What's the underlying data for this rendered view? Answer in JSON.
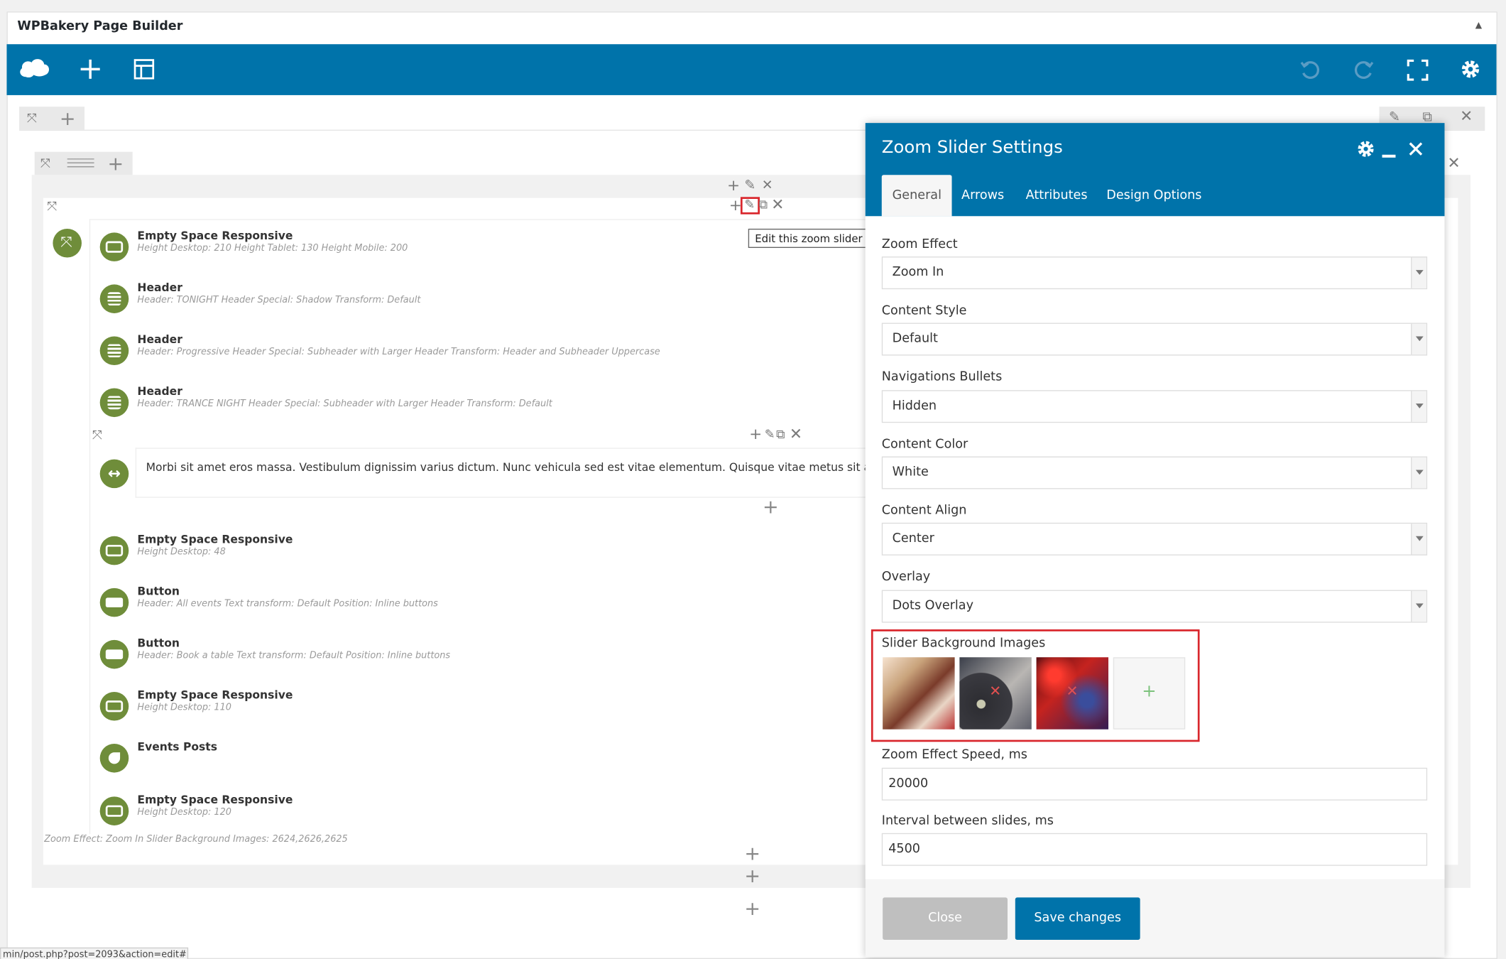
{
  "metabox": {
    "title": "WPBakery Page Builder",
    "toggle": "▲"
  },
  "navbar": {
    "logo": "cloud-logo-icon",
    "add": "plus-icon",
    "templates": "layout-icon",
    "undo": "undo-icon",
    "redo": "redo-icon",
    "fullscreen": "fullscreen-icon",
    "settings": "gear-icon"
  },
  "builder": {
    "tooltip": "Edit this zoom slider",
    "elements": [
      {
        "name": "Empty Space Responsive",
        "desc": "Height Desktop: 210  Height Tablet: 130  Height Mobile: 200"
      },
      {
        "name": "Header",
        "desc": "Header: TONIGHT  Header Special: Shadow  Transform: Default"
      },
      {
        "name": "Header",
        "desc": "Header: Progressive  Header Special: Subheader with Larger Header  Transform: Header and Subheader Uppercase"
      },
      {
        "name": "Header",
        "desc": "Header: TRANCE NIGHT  Header Special: Subheader with Larger Header  Transform: Default"
      }
    ],
    "text_block": "Morbi sit amet eros massa. Vestibulum dignissim varius dictum. Nunc vehicula sed est vitae elementum. Quisque vitae metus sit amet orci por",
    "elements2": [
      {
        "name": "Empty Space Responsive",
        "desc": "Height Desktop: 48"
      },
      {
        "name": "Button",
        "desc": "Header: All events  Text transform: Default  Position: Inline buttons"
      },
      {
        "name": "Button",
        "desc": "Header: Book a table  Text transform: Default  Position: Inline buttons"
      },
      {
        "name": "Empty Space Responsive",
        "desc": "Height Desktop: 110"
      },
      {
        "name": "Events Posts",
        "desc": ""
      },
      {
        "name": "Empty Space Responsive",
        "desc": "Height Desktop: 120"
      }
    ],
    "slider_summary": "Zoom Effect: Zoom In  Slider Background Images: 2624,2626,2625",
    "status_url": "min/post.php?post=2093&action=edit#"
  },
  "modal": {
    "title": "Zoom Slider Settings",
    "tabs": [
      "General",
      "Arrows",
      "Attributes",
      "Design Options"
    ],
    "fields": {
      "zoom_effect": {
        "label": "Zoom Effect",
        "value": "Zoom In"
      },
      "content_style": {
        "label": "Content Style",
        "value": "Default"
      },
      "nav_bullets": {
        "label": "Navigations Bullets",
        "value": "Hidden"
      },
      "content_color": {
        "label": "Content Color",
        "value": "White"
      },
      "content_align": {
        "label": "Content Align",
        "value": "Center"
      },
      "overlay": {
        "label": "Overlay",
        "value": "Dots Overlay"
      },
      "bg_images": {
        "label": "Slider Background Images",
        "add": "+"
      },
      "zoom_speed": {
        "label": "Zoom Effect Speed, ms",
        "value": "20000"
      },
      "interval": {
        "label": "Interval between slides, ms",
        "value": "4500"
      }
    },
    "close_label": "Close",
    "save_label": "Save changes"
  },
  "colors": {
    "accent": "#0073aa",
    "element_icon": "#6f8d3a",
    "highlight": "#d9262c"
  }
}
